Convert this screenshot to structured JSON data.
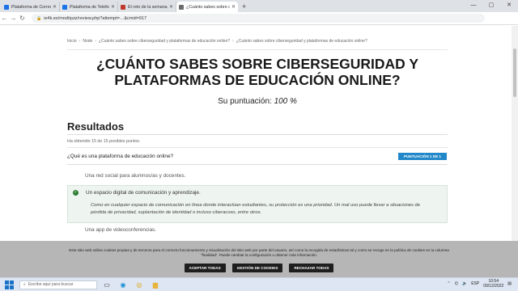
{
  "browser": {
    "tabs": [
      {
        "label": "Plataforma de Correo Electrónic",
        "color": "#1a73e8"
      },
      {
        "label": "Plataforma de Teleformación Gu",
        "color": "#1a73e8"
      },
      {
        "label": "El reto de la semana | Reto | Mé",
        "color": "#c0392b"
      },
      {
        "label": "¿Cuánto sabes sobre ciberseguri",
        "color": "#6b6b6b"
      }
    ],
    "new_tab": "+",
    "url": "ie4k.es/mod/quiz/review.php?attempt=…&cmid=917",
    "controls": [
      "—",
      "▢",
      "✕"
    ]
  },
  "breadcrumb": [
    "Inicio",
    "Node",
    "¿Cuánto sabes sobre ciberseguridad y plataformas de educación online?",
    "¿Cuánto sabes sobre ciberseguridad y plataformas de educación online?"
  ],
  "page": {
    "title": "¿CUÁNTO SABES SOBRE CIBERSEGURIDAD Y PLATAFORMAS DE EDUCACIÓN ONLINE?",
    "score_label": "Su puntuación:",
    "score_value": "100 %",
    "results_heading": "Resultados",
    "obtained": "Ha obtenido 15 de 15 posibles puntos.",
    "question": "¿Qué es una plataforma de educación online?",
    "badge": "PUNTUACIÓN 1 DE 1",
    "options": [
      {
        "text": "Una red social para alumnos/as y docentes.",
        "correct": false
      },
      {
        "text": "Un espacio digital de comunicación y aprendizaje.",
        "correct": true,
        "feedback": "Como en cualquier espacio de comunicación en línea donde interactúan estudiantes, su protección es una prioridad. Un mal uso puede llevar a situaciones de pérdida de privacidad, suplantación de identidad o incluso ciberacoso, entre otros."
      },
      {
        "text": "Una app de videoconferencias.",
        "correct": false
      }
    ]
  },
  "cookie_banner": {
    "text": "Este sitio web utiliza cookies propias y de terceros para el correcto funcionamiento y visualización del sitio web por parte del usuario, así como la recogida de estadísticas tal y como se recoge en la política de cookies en la columna \"finalidad\". Puede cambiar la configuración u obtener más información.",
    "buttons": [
      "ACEPTAR TODAS",
      "GESTIÓN DE COOKIES",
      "RECHAZAR TODAS"
    ]
  },
  "taskbar": {
    "search_placeholder": "Escribe aquí para buscar",
    "time": "10:54",
    "date": "09/12/2022",
    "lang": "ESP"
  },
  "colors": {
    "accent": "#2388c9",
    "correct": "#2e7d32",
    "correct_bg": "#eef4ef"
  }
}
